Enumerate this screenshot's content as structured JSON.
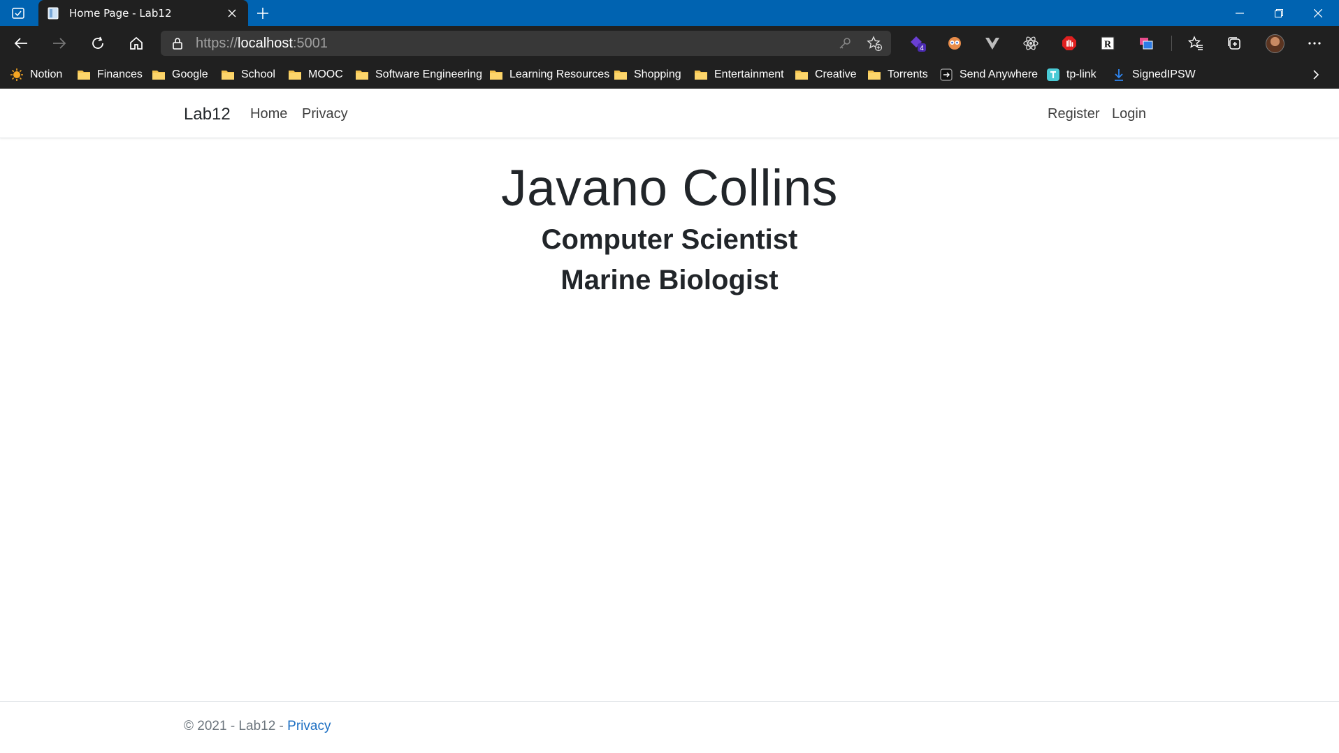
{
  "browser": {
    "tab_title": "Home Page - Lab12",
    "url_scheme": "https://",
    "url_host": "localhost",
    "url_port": ":5001",
    "extension_badge": "4",
    "bookmarks": [
      {
        "label": "Notion",
        "icon": "notion-icon"
      },
      {
        "label": "Finances",
        "icon": "folder-icon"
      },
      {
        "label": "Google",
        "icon": "folder-icon"
      },
      {
        "label": "School",
        "icon": "folder-icon"
      },
      {
        "label": "MOOC",
        "icon": "folder-icon"
      },
      {
        "label": "Software Engineering",
        "icon": "folder-icon"
      },
      {
        "label": "Learning Resources",
        "icon": "folder-icon"
      },
      {
        "label": "Shopping",
        "icon": "folder-icon"
      },
      {
        "label": "Entertainment",
        "icon": "folder-icon"
      },
      {
        "label": "Creative",
        "icon": "folder-icon"
      },
      {
        "label": "Torrents",
        "icon": "folder-icon"
      },
      {
        "label": "Send Anywhere",
        "icon": "send-anywhere-icon"
      },
      {
        "label": "tp-link",
        "icon": "tplink-icon"
      },
      {
        "label": "SignedIPSW",
        "icon": "download-icon"
      }
    ],
    "colors": {
      "titlebar": "#0063b1",
      "chrome": "#202020",
      "omnibox": "#383838",
      "folder": "#f3c14b"
    }
  },
  "site": {
    "brand": "Lab12",
    "nav": {
      "home": "Home",
      "privacy": "Privacy",
      "register": "Register",
      "login": "Login"
    },
    "hero": {
      "name": "Javano Collins",
      "role1": "Computer Scientist",
      "role2": "Marine Biologist"
    },
    "footer": {
      "copyright": "© 2021 - Lab12 - ",
      "privacy_link": "Privacy"
    },
    "colors": {
      "text": "#212529",
      "link": "#1b6ec2",
      "muted": "#6c757d"
    }
  }
}
